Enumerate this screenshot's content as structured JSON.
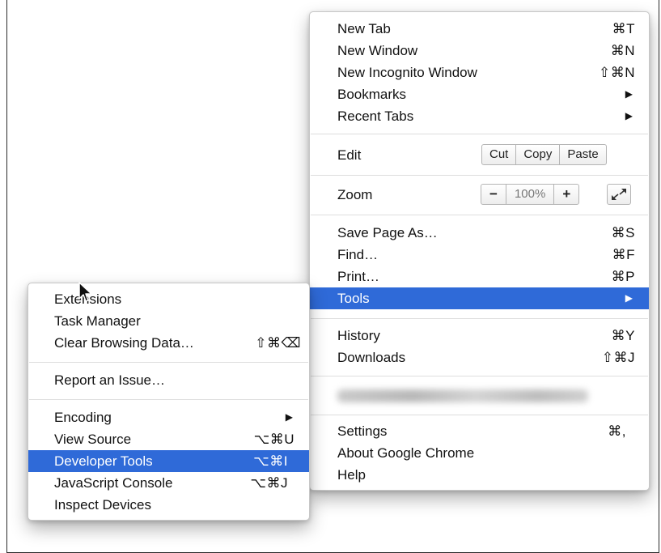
{
  "main_menu": {
    "new_tab": {
      "label": "New Tab",
      "shortcut": "⌘T"
    },
    "new_window": {
      "label": "New Window",
      "shortcut": "⌘N"
    },
    "new_incognito": {
      "label": "New Incognito Window",
      "shortcut": "⇧⌘N"
    },
    "bookmarks": {
      "label": "Bookmarks"
    },
    "recent_tabs": {
      "label": "Recent Tabs"
    },
    "edit": {
      "label": "Edit",
      "cut": "Cut",
      "copy": "Copy",
      "paste": "Paste"
    },
    "zoom": {
      "label": "Zoom",
      "minus": "−",
      "value": "100%",
      "plus": "+"
    },
    "save_page": {
      "label": "Save Page As…",
      "shortcut": "⌘S"
    },
    "find": {
      "label": "Find…",
      "shortcut": "⌘F"
    },
    "print": {
      "label": "Print…",
      "shortcut": "⌘P"
    },
    "tools": {
      "label": "Tools"
    },
    "history": {
      "label": "History",
      "shortcut": "⌘Y"
    },
    "downloads": {
      "label": "Downloads",
      "shortcut": "⇧⌘J"
    },
    "settings": {
      "label": "Settings",
      "shortcut": "⌘,"
    },
    "about": {
      "label": "About Google Chrome"
    },
    "help": {
      "label": "Help"
    }
  },
  "tools_submenu": {
    "extensions": {
      "label": "Extensions"
    },
    "task_manager": {
      "label": "Task Manager"
    },
    "clear_browsing": {
      "label": "Clear Browsing Data…",
      "shortcut": "⇧⌘⌫"
    },
    "report_issue": {
      "label": "Report an Issue…"
    },
    "encoding": {
      "label": "Encoding"
    },
    "view_source": {
      "label": "View Source",
      "shortcut": "⌥⌘U"
    },
    "developer_tools": {
      "label": "Developer Tools",
      "shortcut": "⌥⌘I"
    },
    "js_console": {
      "label": "JavaScript Console",
      "shortcut": "⌥⌘J"
    },
    "inspect_devices": {
      "label": "Inspect Devices"
    }
  },
  "colors": {
    "selection": "#2f6ad8"
  }
}
